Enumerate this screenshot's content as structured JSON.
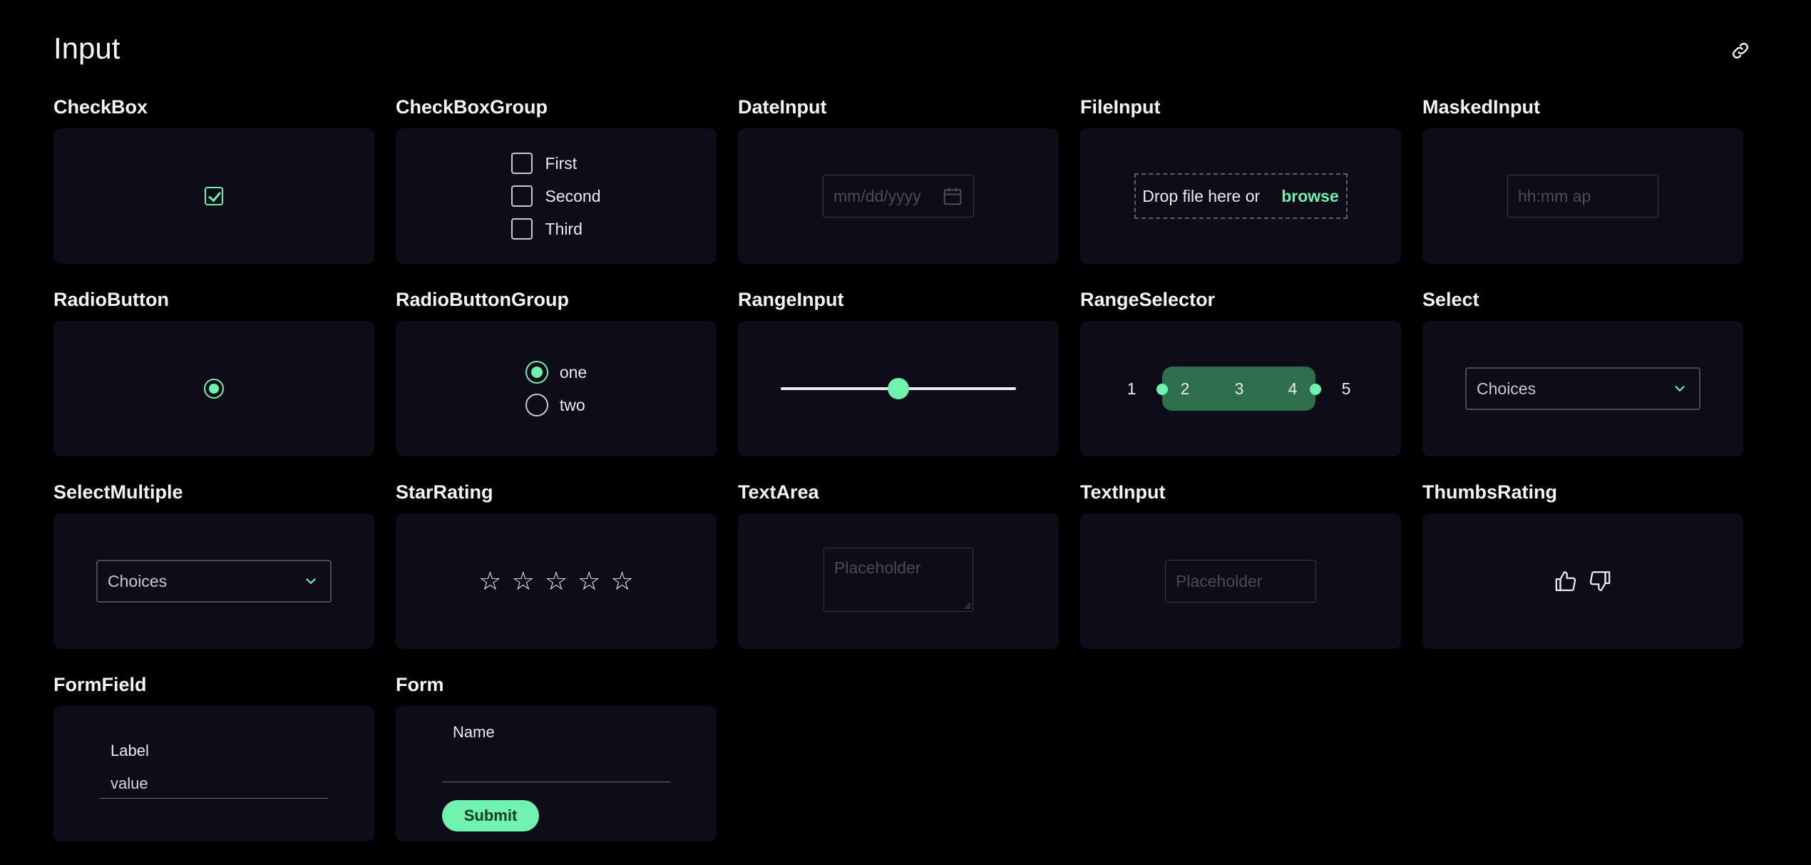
{
  "page": {
    "title": "Input"
  },
  "sections": {
    "checkbox": {
      "title": "CheckBox",
      "checked": true
    },
    "checkbox_group": {
      "title": "CheckBoxGroup",
      "options": [
        "First",
        "Second",
        "Third"
      ]
    },
    "date_input": {
      "title": "DateInput",
      "placeholder": "mm/dd/yyyy"
    },
    "file_input": {
      "title": "FileInput",
      "drop_text": "Drop file here or",
      "browse_label": "browse"
    },
    "masked_input": {
      "title": "MaskedInput",
      "placeholder": "hh:mm ap"
    },
    "radio_button": {
      "title": "RadioButton",
      "selected": true
    },
    "radio_button_group": {
      "title": "RadioButtonGroup",
      "options": [
        "one",
        "two"
      ],
      "selected": "one"
    },
    "range_input": {
      "title": "RangeInput",
      "value_fraction": 0.5
    },
    "range_selector": {
      "title": "RangeSelector",
      "numbers": [
        "1",
        "2",
        "3",
        "4",
        "5"
      ],
      "selected_range": [
        2,
        4
      ]
    },
    "select": {
      "title": "Select",
      "value": "Choices"
    },
    "select_multiple": {
      "title": "SelectMultiple",
      "value": "Choices"
    },
    "star_rating": {
      "title": "StarRating",
      "stars": 5,
      "glyph": "☆"
    },
    "text_area": {
      "title": "TextArea",
      "placeholder": "Placeholder"
    },
    "text_input": {
      "title": "TextInput",
      "placeholder": "Placeholder"
    },
    "thumbs_rating": {
      "title": "ThumbsRating"
    },
    "form_field": {
      "title": "FormField",
      "label": "Label",
      "value": "value"
    },
    "form": {
      "title": "Form",
      "field_label": "Name",
      "submit_label": "Submit"
    }
  },
  "colors": {
    "accent": "#6ef2ad",
    "card_bg": "#0d0c18",
    "page_bg": "#000000",
    "range_band": "#2d6e4c"
  },
  "icons": [
    "link-icon",
    "calendar-icon",
    "chevron-down-icon",
    "thumbs-up-icon",
    "thumbs-down-icon",
    "star-icon"
  ]
}
